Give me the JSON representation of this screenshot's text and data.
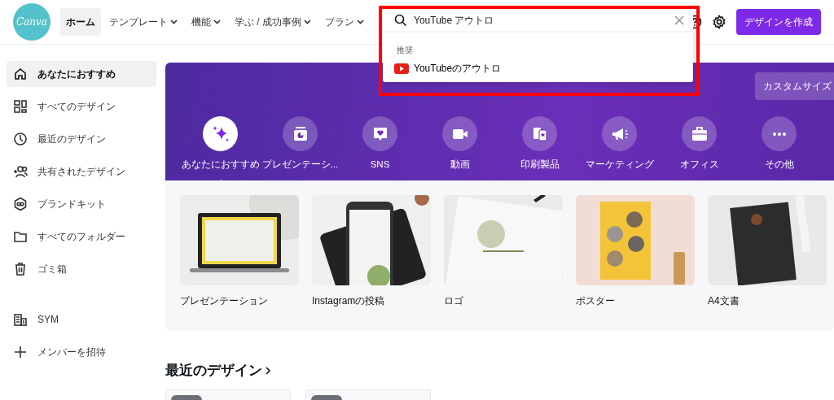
{
  "logo": "Canva",
  "nav": [
    {
      "label": "ホーム",
      "selected": true,
      "dropdown": false
    },
    {
      "label": "テンプレート",
      "selected": false,
      "dropdown": true
    },
    {
      "label": "機能",
      "selected": false,
      "dropdown": true
    },
    {
      "label": "学ぶ / 成功事例",
      "selected": false,
      "dropdown": true
    },
    {
      "label": "プラン",
      "selected": false,
      "dropdown": true
    }
  ],
  "search": {
    "value": "YouTube アウトロ",
    "section": "推奨",
    "suggestions": [
      {
        "label": "YouTubeのアウトロ"
      }
    ]
  },
  "create_button": "デザインを作成",
  "sidebar": {
    "items": [
      {
        "label": "あなたにおすすめ",
        "selected": true
      },
      {
        "label": "すべてのデザイン",
        "selected": false
      },
      {
        "label": "最近のデザイン",
        "selected": false
      },
      {
        "label": "共有されたデザイン",
        "selected": false
      },
      {
        "label": "ブランドキット",
        "selected": false
      },
      {
        "label": "すべてのフォルダー",
        "selected": false
      },
      {
        "label": "ゴミ箱",
        "selected": false
      }
    ],
    "team_items": [
      {
        "label": "SYM"
      },
      {
        "label": "メンバーを招待"
      }
    ]
  },
  "hero": {
    "custom_size_button": "カスタムサイズ",
    "categories": [
      {
        "label": "あなたにおすすめ",
        "selected": true
      },
      {
        "label": "プレゼンテーシ...",
        "selected": false
      },
      {
        "label": "SNS",
        "selected": false
      },
      {
        "label": "動画",
        "selected": false
      },
      {
        "label": "印刷製品",
        "selected": false
      },
      {
        "label": "マーケティング",
        "selected": false
      },
      {
        "label": "オフィス",
        "selected": false
      },
      {
        "label": "その他",
        "selected": false
      }
    ]
  },
  "templates": [
    {
      "label": "プレゼンテーション"
    },
    {
      "label": "Instagramの投稿"
    },
    {
      "label": "ロゴ"
    },
    {
      "label": "ポスター"
    },
    {
      "label": "A4文書"
    }
  ],
  "recent": {
    "title": "最近のデザイン",
    "cards": [
      {
        "badge": true
      },
      {
        "badge": true
      }
    ]
  }
}
